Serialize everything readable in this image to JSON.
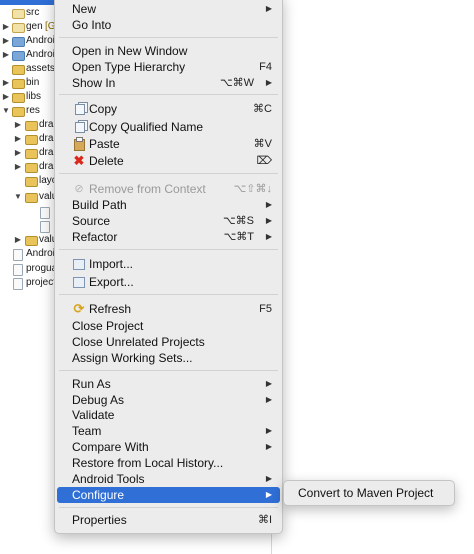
{
  "tree": {
    "items": [
      {
        "label": "src",
        "suffix": ""
      },
      {
        "label": "gen",
        "suffix": "[G"
      },
      {
        "label": "Androi",
        "suffix": ""
      },
      {
        "label": "Androi",
        "suffix": ""
      },
      {
        "label": "assets",
        "suffix": ""
      },
      {
        "label": "bin",
        "suffix": ""
      },
      {
        "label": "libs",
        "suffix": ""
      },
      {
        "label": "res",
        "suffix": ""
      },
      {
        "label": "dra",
        "suffix": ""
      },
      {
        "label": "dra",
        "suffix": ""
      },
      {
        "label": "dra",
        "suffix": ""
      },
      {
        "label": "dra",
        "suffix": ""
      },
      {
        "label": "layo",
        "suffix": ""
      },
      {
        "label": "valu",
        "suffix": ""
      },
      {
        "label": "",
        "suffix": ""
      },
      {
        "label": "",
        "suffix": ""
      },
      {
        "label": "valu",
        "suffix": ""
      },
      {
        "label": "Androi",
        "suffix": ""
      },
      {
        "label": "progua",
        "suffix": ""
      },
      {
        "label": "project",
        "suffix": ""
      }
    ]
  },
  "menu": {
    "new": {
      "label": "New"
    },
    "go_into": {
      "label": "Go Into"
    },
    "open_new_window": {
      "label": "Open in New Window"
    },
    "open_type_hierarchy": {
      "label": "Open Type Hierarchy",
      "shortcut": "F4"
    },
    "show_in": {
      "label": "Show In",
      "shortcut": "⌥⌘W"
    },
    "copy": {
      "label": "Copy",
      "shortcut": "⌘C"
    },
    "copy_qualified": {
      "label": "Copy Qualified Name"
    },
    "paste": {
      "label": "Paste",
      "shortcut": "⌘V"
    },
    "delete": {
      "label": "Delete",
      "shortcut": "⌦"
    },
    "remove_context": {
      "label": "Remove from Context",
      "shortcut": "⌥⇧⌘↓"
    },
    "build_path": {
      "label": "Build Path"
    },
    "source": {
      "label": "Source",
      "shortcut": "⌥⌘S"
    },
    "refactor": {
      "label": "Refactor",
      "shortcut": "⌥⌘T"
    },
    "import": {
      "label": "Import..."
    },
    "export": {
      "label": "Export..."
    },
    "refresh": {
      "label": "Refresh",
      "shortcut": "F5"
    },
    "close_project": {
      "label": "Close Project"
    },
    "close_unrelated": {
      "label": "Close Unrelated Projects"
    },
    "assign_working_sets": {
      "label": "Assign Working Sets..."
    },
    "run_as": {
      "label": "Run As"
    },
    "debug_as": {
      "label": "Debug As"
    },
    "validate": {
      "label": "Validate"
    },
    "team": {
      "label": "Team"
    },
    "compare_with": {
      "label": "Compare With"
    },
    "restore_history": {
      "label": "Restore from Local History..."
    },
    "android_tools": {
      "label": "Android Tools"
    },
    "configure": {
      "label": "Configure"
    },
    "properties": {
      "label": "Properties",
      "shortcut": "⌘I"
    }
  },
  "submenu": {
    "convert_maven": {
      "label": "Convert to Maven Project"
    }
  },
  "colors": {
    "selection": "#2f6fd6",
    "menu_bg": "#ececec",
    "delete_icon": "#d9281c",
    "refresh_icon": "#d8a51f"
  }
}
